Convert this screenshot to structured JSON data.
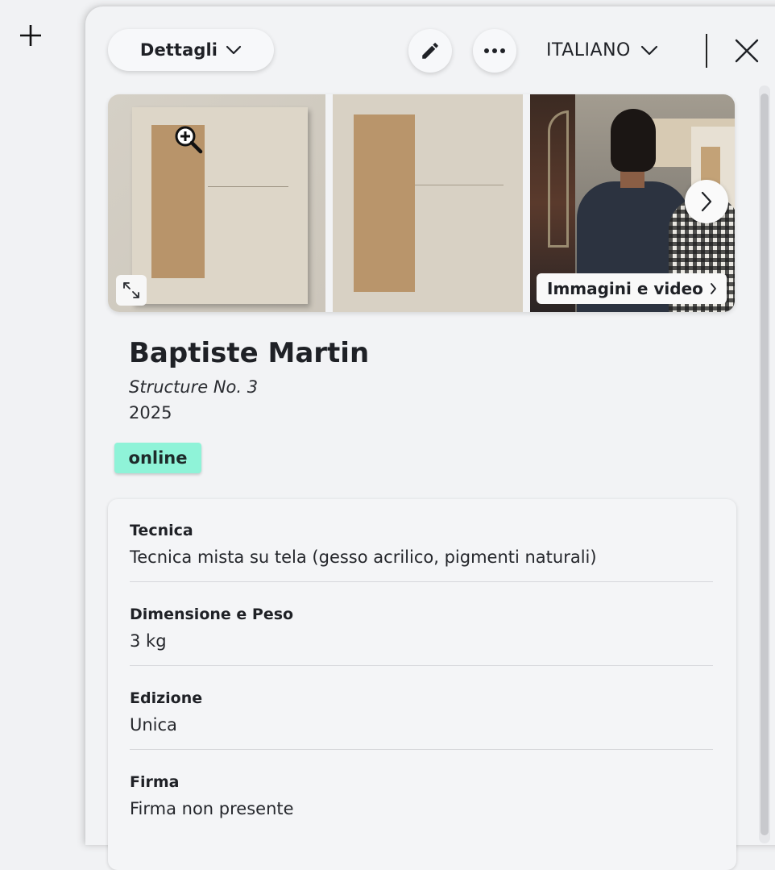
{
  "toolbar": {
    "view_label": "Dettagli",
    "language_label": "ITALIANO"
  },
  "gallery": {
    "media_link_label": "Immagini e video"
  },
  "artwork": {
    "artist": "Baptiste Martin",
    "title": "Structure No. 3",
    "year": "2025",
    "status": "online",
    "status_color": "#8ff3d8"
  },
  "details": [
    {
      "label": "Tecnica",
      "value": "Tecnica mista su tela (gesso acrilico, pigmenti naturali)"
    },
    {
      "label": "Dimensione e Peso",
      "value": "3 kg"
    },
    {
      "label": "Edizione",
      "value": "Unica"
    },
    {
      "label": "Firma",
      "value": "Firma non presente"
    }
  ],
  "icons": {
    "add": "plus-icon",
    "view_dropdown": "chevron-down-icon",
    "edit": "pencil-icon",
    "more": "ellipsis-icon",
    "language_dropdown": "chevron-down-icon",
    "close": "close-icon",
    "zoom": "zoom-in-icon",
    "expand": "expand-icon",
    "next": "chevron-right-icon"
  }
}
